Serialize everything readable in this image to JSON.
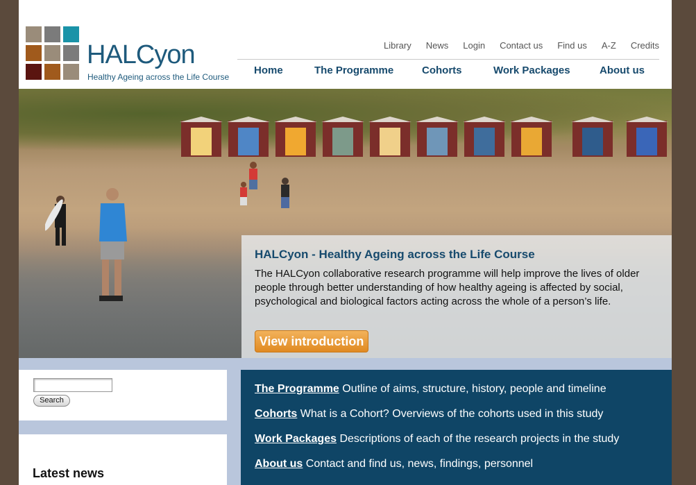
{
  "logo": {
    "word": "HALCyon",
    "tagline": "Healthy Ageing across the Life Course",
    "squares": [
      "#9a8c7a",
      "#7b7b7b",
      "#1a93a8",
      "#a05a1c",
      "#9a8c7a",
      "#7b7b7b",
      "#5a1410",
      "#a05a1c",
      "#9a8c7a"
    ]
  },
  "utility_nav": [
    {
      "label": "Library"
    },
    {
      "label": "News"
    },
    {
      "label": "Login"
    },
    {
      "label": "Contact us"
    },
    {
      "label": "Find us"
    },
    {
      "label": "A-Z"
    },
    {
      "label": "Credits"
    }
  ],
  "main_nav": [
    {
      "label": "Home"
    },
    {
      "label": "The Programme"
    },
    {
      "label": "Cohorts"
    },
    {
      "label": "Work Packages"
    },
    {
      "label": "About us"
    }
  ],
  "hero": {
    "title": "HALCyon - Healthy Ageing across the Life Course",
    "text": "The HALCyon collaborative research programme will help improve the lives of older people through better understanding of how healthy ageing is affected by social, psychological and biological factors acting across the whole of a person’s life.",
    "button": "View introduction"
  },
  "search": {
    "value": "",
    "button": "Search"
  },
  "news": {
    "title": "Latest news"
  },
  "links": [
    {
      "label": "The Programme",
      "desc": " Outline of aims, structure, history, people and timeline"
    },
    {
      "label": "Cohorts",
      "desc": " What is a Cohort? Overviews of the cohorts used in this study"
    },
    {
      "label": "Work Packages",
      "desc": " Descriptions of each of the research projects in the study"
    },
    {
      "label": "About us",
      "desc": " Contact and find us, news, findings, personnel"
    }
  ],
  "colors": {
    "brand_blue": "#174a6d",
    "links_panel": "#0f4566",
    "button_orange": "#e08a22",
    "outer_bg": "#5b4a3c"
  }
}
